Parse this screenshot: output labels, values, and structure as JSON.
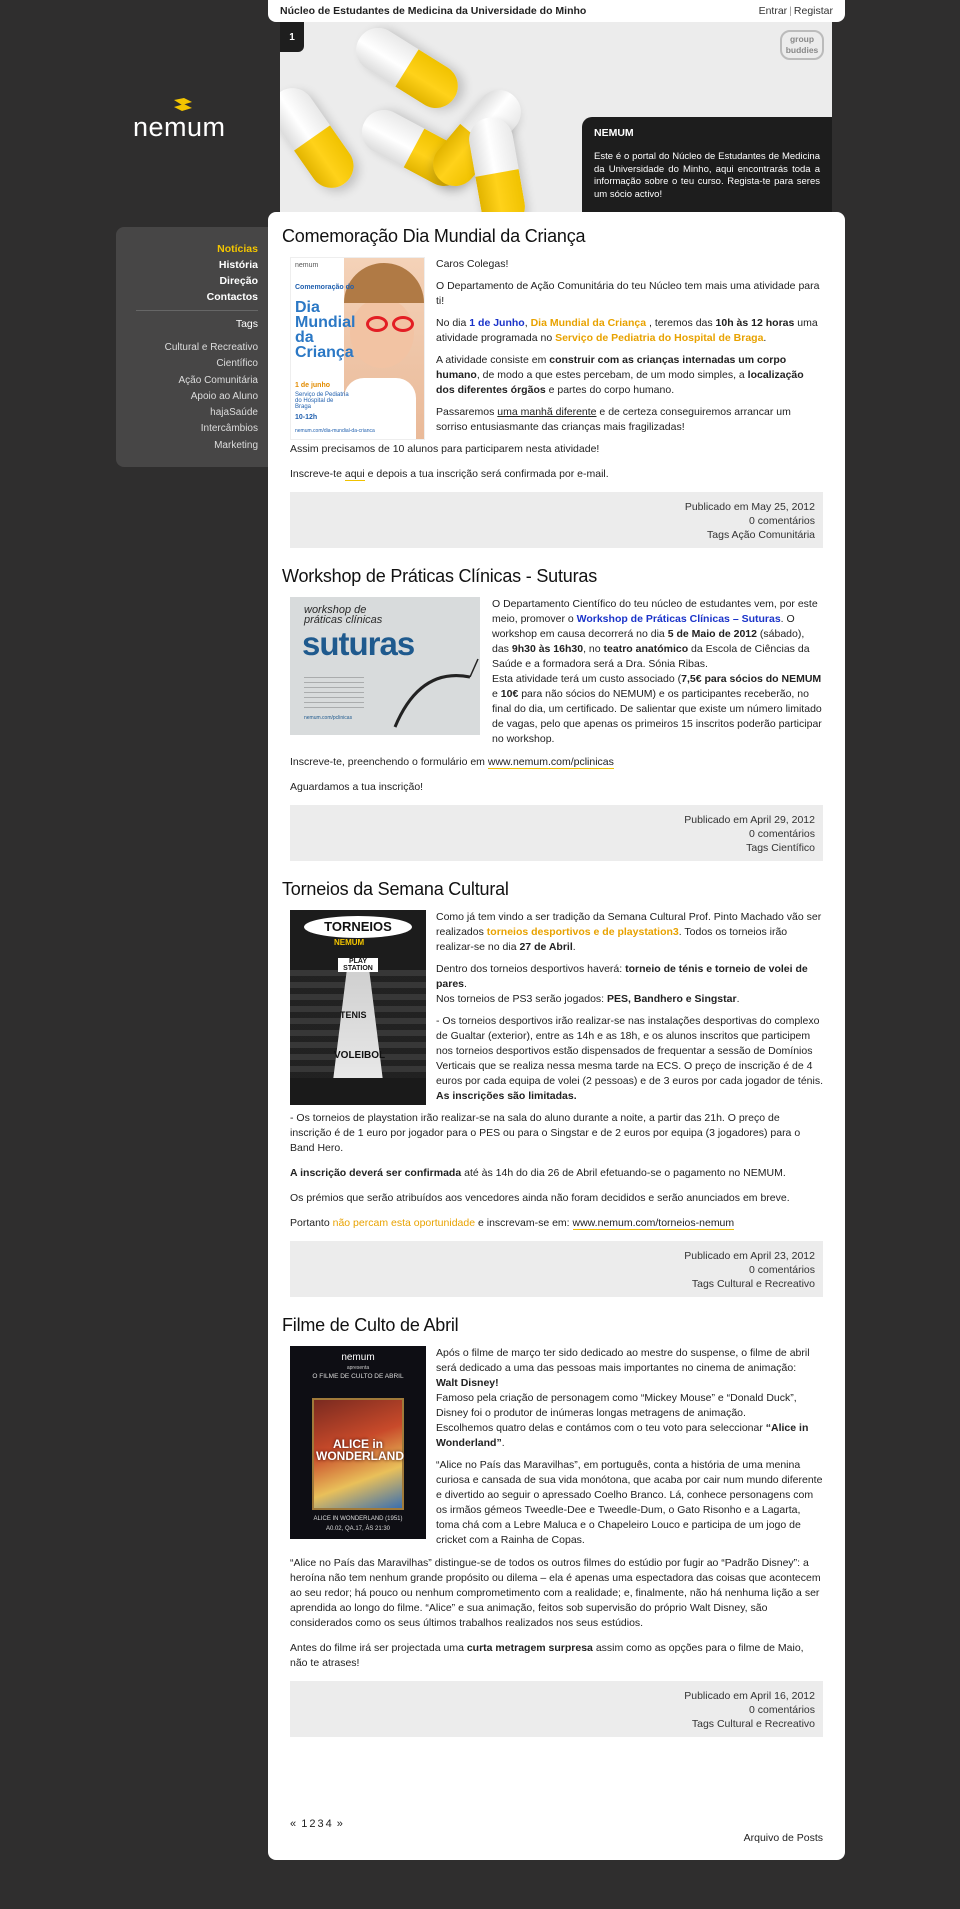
{
  "topbar": {
    "site_name": "Núcleo de Estudantes de Medicina da Universidade do Minho",
    "login": "Entrar",
    "register": "Registar"
  },
  "header": {
    "slide_number": "1",
    "partner_logo": "group buddies",
    "info_title": "NEMUM",
    "info_text": "Este é o portal do Núcleo de Estudantes de Medicina da Universidade do Minho, aqui encontrarás toda a informação sobre o teu curso. Regista-te para seres um sócio activo!"
  },
  "logo": {
    "text": "nemum"
  },
  "sidebar": {
    "nav": [
      "Notícias",
      "História",
      "Direção",
      "Contactos"
    ],
    "tags_title": "Tags",
    "tags": [
      "Cultural e Recreativo",
      "Científico",
      "Ação Comunitária",
      "Apoio ao Aluno",
      "hajaSaúde",
      "Intercâmbios",
      "Marketing"
    ]
  },
  "posts": [
    {
      "title": "Comemoração Dia Mundial da Criança",
      "poster": {
        "brand": "nemum",
        "line1": "Comemoração do",
        "big": "Dia Mundial da Criança",
        "date": "1 de junho",
        "place": "Serviço de Pediatria do Hospital de Braga",
        "time": "10-12h",
        "url": "nemum.com/dia-mundial-da-crianca"
      },
      "p1": "Caros Colegas!",
      "p2": "O Departamento de Ação Comunitária do teu Núcleo tem mais uma atividade para ti!",
      "p3_a": "No dia ",
      "p3_b": "1 de Junho",
      "p3_c": ", ",
      "p3_d": "Dia Mundial da Criança",
      "p3_e": " , teremos das ",
      "p3_f": "10h às 12 horas",
      "p3_g": " uma atividade programada no ",
      "p3_h": "Serviço de Pediatria do Hospital de Braga",
      "p3_i": ".",
      "p4_a": "A atividade consiste em ",
      "p4_b": "construir com as crianças internadas um corpo humano",
      "p4_c": ", de modo a que estes percebam, de um modo simples, a ",
      "p4_d": "localização dos diferentes órgãos",
      "p4_e": " e partes do corpo humano.",
      "p5_a": "Passaremos ",
      "p5_b": "uma manhã diferente",
      "p5_c": " e de certeza conseguiremos arrancar um sorriso entusiasmante das crianças mais fragilizadas!",
      "p6": "Assim precisamos de 10 alunos para participarem nesta atividade!",
      "p7_a": "Inscreve-te ",
      "p7_b": "aqui",
      "p7_c": " e depois a tua inscrição será confirmada por e-mail.",
      "meta_date": "Publicado em May 25, 2012",
      "meta_comments": "0 comentários",
      "meta_tags": "Tags Ação Comunitária"
    },
    {
      "title": "Workshop de Práticas Clínicas - Suturas",
      "poster": {
        "line1": "workshop de práticas clínicas",
        "big": "suturas",
        "url": "nemum.com/pclinicas"
      },
      "p1_a": "O Departamento Científico do teu núcleo de estudantes vem, por este meio, promover o ",
      "p1_b": "Workshop de Práticas Clínicas – Suturas",
      "p1_c": ". O workshop em causa decorrerá no dia ",
      "p1_d": "5 de Maio de 2012",
      "p1_e": " (sábado), das ",
      "p1_f": "9h30 às 16h30",
      "p1_g": ", no ",
      "p1_h": "teatro anatómico",
      "p1_i": " da Escola de Ciências da Saúde e a formadora será a Dra. Sónia Ribas.",
      "p1_j": "Esta atividade terá um custo associado (",
      "p1_k": "7,5€ para sócios do NEMUM",
      "p1_l": " e ",
      "p1_m": "10€",
      "p1_n": " para não sócios do NEMUM) e os participantes receberão, no final do dia, um certificado. De salientar que existe um número limitado de vagas, pelo que apenas os primeiros 15 inscritos poderão participar no workshop.",
      "p2_a": "Inscreve-te, preenchendo o formulário em ",
      "p2_b": "www.nemum.com/pclinicas",
      "p3": "Aguardamos a tua inscrição!",
      "meta_date": "Publicado em April 29, 2012",
      "meta_comments": "0 comentários",
      "meta_tags": "Tags Científico"
    },
    {
      "title": "Torneios da Semana Cultural",
      "poster": {
        "top": "TORNEIOS",
        "brand": "NEMUM",
        "l1": "PLAY STATION",
        "l2": "TENIS",
        "l3": "VOLEIBOL"
      },
      "p1_a": "Como já tem vindo a ser tradição da Semana Cultural Prof. Pinto Machado vão ser realizados ",
      "p1_b": "torneios desportivos e de playstation3",
      "p1_c": ". Todos os torneios irão realizar-se no dia ",
      "p1_d": "27 de Abril",
      "p1_e": ".",
      "p2_a": "Dentro dos torneios desportivos haverá: ",
      "p2_b": "torneio de ténis e torneio de volei de pares",
      "p2_c": ".",
      "p2_d": "Nos torneios de PS3 serão jogados: ",
      "p2_e": "PES, Bandhero e Singstar",
      "p2_f": ".",
      "p3_a": "- Os torneios desportivos irão realizar-se nas instalações desportivas do complexo de Gualtar (exterior), entre as 14h e as 18h, e os alunos inscritos que participem nos torneios desportivos estão dispensados de frequentar a sessão de Domínios Verticais que se realiza nessa mesma tarde na ECS. O preço de inscrição é de 4 euros por cada equipa de volei (2 pessoas) e de 3 euros por cada jogador de ténis. ",
      "p3_b": "As inscrições são limitadas.",
      "p4": "- Os torneios de playstation irão realizar-se na sala do aluno durante a noite, a partir das 21h. O preço de inscrição é de 1 euro por jogador para o PES ou para o Singstar e de 2 euros por equipa (3 jogadores) para o Band Hero.",
      "p5_a": "A inscrição deverá ser confirmada",
      "p5_b": " até às 14h do dia 26 de Abril efetuando-se o pagamento no NEMUM.",
      "p6": "Os prémios que serão atribuídos aos vencedores ainda não foram decididos e serão anunciados em breve.",
      "p7_a": "Portanto ",
      "p7_b": "não percam esta oportunidade",
      "p7_c": " e inscrevam-se em: ",
      "p7_d": "www.nemum.com/torneios-nemum",
      "meta_date": "Publicado em April 23, 2012",
      "meta_comments": "0 comentários",
      "meta_tags": "Tags Cultural e Recreativo"
    },
    {
      "title": "Filme de Culto de Abril",
      "poster": {
        "brand": "nemum",
        "sub": "apresenta",
        "line1": "O FILME DE CULTO DE ABRIL",
        "film": "ALICE in WONDERLAND",
        "caption": "ALICE IN WONDERLAND (1951)",
        "when": "A0.02, QA.17, ÀS 21:30"
      },
      "p1_a": "Após o filme de março ter sido dedicado ao mestre do suspense, o filme de abril será dedicado a uma das pessoas mais importantes no cinema de animação: ",
      "p1_b": "Walt Disney!",
      "p1_c": "Famoso pela criação de personagem como “Mickey Mouse” e “Donald Duck”, Disney foi o produtor de inúmeras longas metragens de animação.",
      "p1_d": "Escolhemos quatro delas e contámos com o teu voto para seleccionar ",
      "p1_e": "“Alice in Wonderland”",
      "p1_f": ".",
      "p2": "“Alice no País das Maravilhas”, em português, conta a história de uma menina curiosa e cansada de sua vida monótona, que acaba por cair num mundo diferente e divertido ao seguir o apressado Coelho Branco. Lá, conhece personagens com os irmãos gémeos Tweedle-Dee e Tweedle-Dum, o Gato Risonho e a Lagarta, toma chá com a Lebre Maluca e o Chapeleiro Louco e participa de um jogo de cricket com a Rainha de Copas.",
      "p3": "“Alice no País das Maravilhas” distingue-se de todos os outros filmes do estúdio por fugir ao “Padrão Disney”: a heroína não tem nenhum grande propósito ou dilema – ela é apenas uma espectadora das coisas que acontecem ao seu redor; há pouco ou nenhum comprometimento com a realidade; e, finalmente, não há nenhuma lição a ser aprendida ao longo do filme. “Alice” e sua animação, feitos sob supervisão do próprio Walt Disney, são considerados como os seus últimos trabalhos realizados nos seus estúdios.",
      "p4_a": "Antes do filme irá ser projectada uma ",
      "p4_b": "curta metragem surpresa",
      "p4_c": " assim como as opções para o filme de Maio, não te atrases!",
      "meta_date": "Publicado em April 16, 2012",
      "meta_comments": "0 comentários",
      "meta_tags": "Tags Cultural e Recreativo"
    }
  ],
  "pager": {
    "prev": "«",
    "pages": [
      "1",
      "2",
      "3",
      "4"
    ],
    "next": "»"
  },
  "archive": "Arquivo de Posts"
}
